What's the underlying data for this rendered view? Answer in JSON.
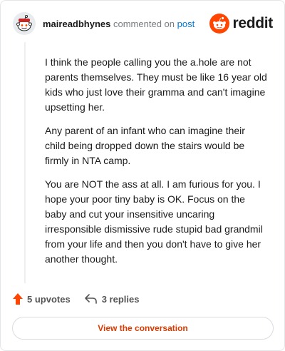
{
  "header": {
    "username": "maireadbhynes",
    "action_text": "commented on",
    "post_link": "post",
    "brand": "reddit"
  },
  "comment": {
    "paragraphs": [
      "I think the people calling you the a.hole are not parents themselves. They must be like 16 year old kids who just love their gramma and can't imagine upsetting her.",
      "Any parent of an infant who can imagine their child being dropped down the stairs would be firmly in NTA camp.",
      "You are NOT the ass at all. I am furious for you. I hope your poor tiny baby is OK. Focus on the baby and cut your insensitive uncaring irresponsible dismissive rude stupid bad grandmil from your life and then you don't have to give her another thought."
    ]
  },
  "actions": {
    "upvotes": "5 upvotes",
    "replies": "3 replies"
  },
  "cta": {
    "label": "View the conversation"
  },
  "colors": {
    "brand_orange": "#ff4500",
    "link_blue": "#0079d3",
    "cta_text": "#d93a00"
  },
  "icons": [
    "user-avatar",
    "reddit-logo-icon",
    "upvote-arrow-icon",
    "reply-arrow-icon"
  ]
}
